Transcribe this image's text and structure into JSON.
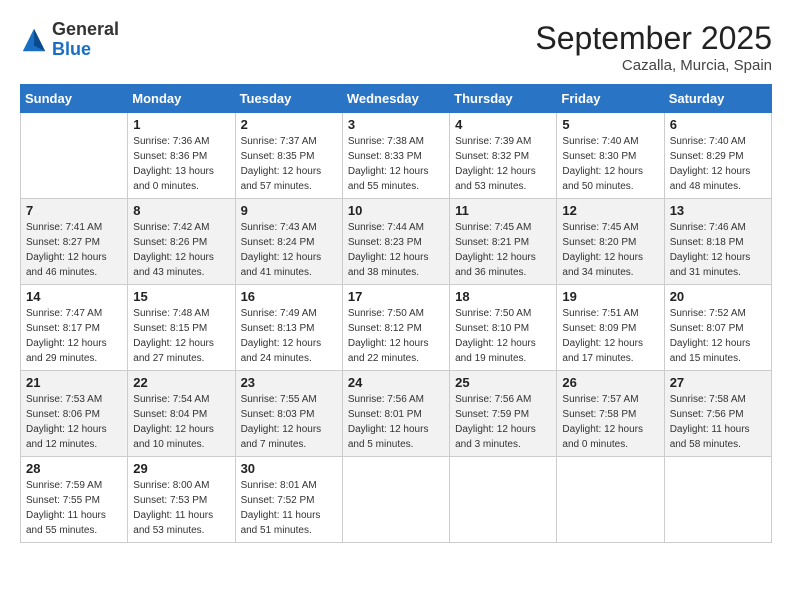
{
  "logo": {
    "general": "General",
    "blue": "Blue"
  },
  "title": "September 2025",
  "location": "Cazalla, Murcia, Spain",
  "headers": [
    "Sunday",
    "Monday",
    "Tuesday",
    "Wednesday",
    "Thursday",
    "Friday",
    "Saturday"
  ],
  "weeks": [
    [
      {
        "day": "",
        "sunrise": "",
        "sunset": "",
        "daylight": ""
      },
      {
        "day": "1",
        "sunrise": "Sunrise: 7:36 AM",
        "sunset": "Sunset: 8:36 PM",
        "daylight": "Daylight: 13 hours and 0 minutes."
      },
      {
        "day": "2",
        "sunrise": "Sunrise: 7:37 AM",
        "sunset": "Sunset: 8:35 PM",
        "daylight": "Daylight: 12 hours and 57 minutes."
      },
      {
        "day": "3",
        "sunrise": "Sunrise: 7:38 AM",
        "sunset": "Sunset: 8:33 PM",
        "daylight": "Daylight: 12 hours and 55 minutes."
      },
      {
        "day": "4",
        "sunrise": "Sunrise: 7:39 AM",
        "sunset": "Sunset: 8:32 PM",
        "daylight": "Daylight: 12 hours and 53 minutes."
      },
      {
        "day": "5",
        "sunrise": "Sunrise: 7:40 AM",
        "sunset": "Sunset: 8:30 PM",
        "daylight": "Daylight: 12 hours and 50 minutes."
      },
      {
        "day": "6",
        "sunrise": "Sunrise: 7:40 AM",
        "sunset": "Sunset: 8:29 PM",
        "daylight": "Daylight: 12 hours and 48 minutes."
      }
    ],
    [
      {
        "day": "7",
        "sunrise": "Sunrise: 7:41 AM",
        "sunset": "Sunset: 8:27 PM",
        "daylight": "Daylight: 12 hours and 46 minutes."
      },
      {
        "day": "8",
        "sunrise": "Sunrise: 7:42 AM",
        "sunset": "Sunset: 8:26 PM",
        "daylight": "Daylight: 12 hours and 43 minutes."
      },
      {
        "day": "9",
        "sunrise": "Sunrise: 7:43 AM",
        "sunset": "Sunset: 8:24 PM",
        "daylight": "Daylight: 12 hours and 41 minutes."
      },
      {
        "day": "10",
        "sunrise": "Sunrise: 7:44 AM",
        "sunset": "Sunset: 8:23 PM",
        "daylight": "Daylight: 12 hours and 38 minutes."
      },
      {
        "day": "11",
        "sunrise": "Sunrise: 7:45 AM",
        "sunset": "Sunset: 8:21 PM",
        "daylight": "Daylight: 12 hours and 36 minutes."
      },
      {
        "day": "12",
        "sunrise": "Sunrise: 7:45 AM",
        "sunset": "Sunset: 8:20 PM",
        "daylight": "Daylight: 12 hours and 34 minutes."
      },
      {
        "day": "13",
        "sunrise": "Sunrise: 7:46 AM",
        "sunset": "Sunset: 8:18 PM",
        "daylight": "Daylight: 12 hours and 31 minutes."
      }
    ],
    [
      {
        "day": "14",
        "sunrise": "Sunrise: 7:47 AM",
        "sunset": "Sunset: 8:17 PM",
        "daylight": "Daylight: 12 hours and 29 minutes."
      },
      {
        "day": "15",
        "sunrise": "Sunrise: 7:48 AM",
        "sunset": "Sunset: 8:15 PM",
        "daylight": "Daylight: 12 hours and 27 minutes."
      },
      {
        "day": "16",
        "sunrise": "Sunrise: 7:49 AM",
        "sunset": "Sunset: 8:13 PM",
        "daylight": "Daylight: 12 hours and 24 minutes."
      },
      {
        "day": "17",
        "sunrise": "Sunrise: 7:50 AM",
        "sunset": "Sunset: 8:12 PM",
        "daylight": "Daylight: 12 hours and 22 minutes."
      },
      {
        "day": "18",
        "sunrise": "Sunrise: 7:50 AM",
        "sunset": "Sunset: 8:10 PM",
        "daylight": "Daylight: 12 hours and 19 minutes."
      },
      {
        "day": "19",
        "sunrise": "Sunrise: 7:51 AM",
        "sunset": "Sunset: 8:09 PM",
        "daylight": "Daylight: 12 hours and 17 minutes."
      },
      {
        "day": "20",
        "sunrise": "Sunrise: 7:52 AM",
        "sunset": "Sunset: 8:07 PM",
        "daylight": "Daylight: 12 hours and 15 minutes."
      }
    ],
    [
      {
        "day": "21",
        "sunrise": "Sunrise: 7:53 AM",
        "sunset": "Sunset: 8:06 PM",
        "daylight": "Daylight: 12 hours and 12 minutes."
      },
      {
        "day": "22",
        "sunrise": "Sunrise: 7:54 AM",
        "sunset": "Sunset: 8:04 PM",
        "daylight": "Daylight: 12 hours and 10 minutes."
      },
      {
        "day": "23",
        "sunrise": "Sunrise: 7:55 AM",
        "sunset": "Sunset: 8:03 PM",
        "daylight": "Daylight: 12 hours and 7 minutes."
      },
      {
        "day": "24",
        "sunrise": "Sunrise: 7:56 AM",
        "sunset": "Sunset: 8:01 PM",
        "daylight": "Daylight: 12 hours and 5 minutes."
      },
      {
        "day": "25",
        "sunrise": "Sunrise: 7:56 AM",
        "sunset": "Sunset: 7:59 PM",
        "daylight": "Daylight: 12 hours and 3 minutes."
      },
      {
        "day": "26",
        "sunrise": "Sunrise: 7:57 AM",
        "sunset": "Sunset: 7:58 PM",
        "daylight": "Daylight: 12 hours and 0 minutes."
      },
      {
        "day": "27",
        "sunrise": "Sunrise: 7:58 AM",
        "sunset": "Sunset: 7:56 PM",
        "daylight": "Daylight: 11 hours and 58 minutes."
      }
    ],
    [
      {
        "day": "28",
        "sunrise": "Sunrise: 7:59 AM",
        "sunset": "Sunset: 7:55 PM",
        "daylight": "Daylight: 11 hours and 55 minutes."
      },
      {
        "day": "29",
        "sunrise": "Sunrise: 8:00 AM",
        "sunset": "Sunset: 7:53 PM",
        "daylight": "Daylight: 11 hours and 53 minutes."
      },
      {
        "day": "30",
        "sunrise": "Sunrise: 8:01 AM",
        "sunset": "Sunset: 7:52 PM",
        "daylight": "Daylight: 11 hours and 51 minutes."
      },
      {
        "day": "",
        "sunrise": "",
        "sunset": "",
        "daylight": ""
      },
      {
        "day": "",
        "sunrise": "",
        "sunset": "",
        "daylight": ""
      },
      {
        "day": "",
        "sunrise": "",
        "sunset": "",
        "daylight": ""
      },
      {
        "day": "",
        "sunrise": "",
        "sunset": "",
        "daylight": ""
      }
    ]
  ]
}
